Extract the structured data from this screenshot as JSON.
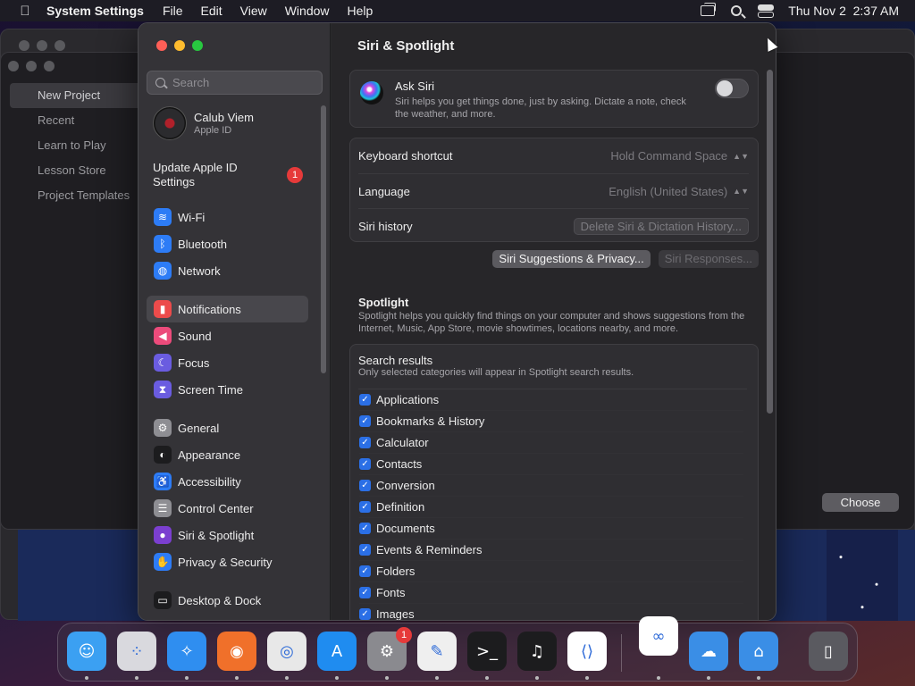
{
  "menubar": {
    "app_name": "System Settings",
    "menus": [
      "File",
      "Edit",
      "View",
      "Window",
      "Help"
    ],
    "datetime": "Thu Nov 2  2:37 AM"
  },
  "background_app": {
    "sidebar_items": [
      "New Project",
      "Recent",
      "Learn to Play",
      "Lesson Store",
      "Project Templates"
    ],
    "choose_button": "Choose"
  },
  "sidebar": {
    "search_placeholder": "Search",
    "profile_name": "Calub Viem",
    "profile_sub": "Apple ID",
    "update_label": "Update Apple ID Settings",
    "update_badge": "1",
    "groups": [
      [
        {
          "label": "Wi-Fi",
          "icon": "wifi-icon",
          "color": "#2d7cf6"
        },
        {
          "label": "Bluetooth",
          "icon": "bluetooth-icon",
          "color": "#2d7cf6"
        },
        {
          "label": "Network",
          "icon": "network-icon",
          "color": "#2d7cf6"
        }
      ],
      [
        {
          "label": "Notifications",
          "icon": "notifications-icon",
          "color": "#ec4b4b",
          "active": true
        },
        {
          "label": "Sound",
          "icon": "sound-icon",
          "color": "#ec4b7b"
        },
        {
          "label": "Focus",
          "icon": "focus-icon",
          "color": "#6a5ce0"
        },
        {
          "label": "Screen Time",
          "icon": "screen-time-icon",
          "color": "#6a5ce0"
        }
      ],
      [
        {
          "label": "General",
          "icon": "general-icon",
          "color": "#8e8e93"
        },
        {
          "label": "Appearance",
          "icon": "appearance-icon",
          "color": "#1c1c1e"
        },
        {
          "label": "Accessibility",
          "icon": "accessibility-icon",
          "color": "#2d7cf6"
        },
        {
          "label": "Control Center",
          "icon": "control-center-icon",
          "color": "#8e8e93"
        },
        {
          "label": "Siri & Spotlight",
          "icon": "siri-icon",
          "color": "#7b3fd0"
        },
        {
          "label": "Privacy & Security",
          "icon": "privacy-hand-icon",
          "color": "#2d7cf6"
        }
      ],
      [
        {
          "label": "Desktop & Dock",
          "icon": "desktop-dock-icon",
          "color": "#1c1c1e"
        }
      ]
    ]
  },
  "main": {
    "title": "Siri & Spotlight",
    "ask_siri": {
      "title": "Ask Siri",
      "description": "Siri helps you get things done, just by asking. Dictate a note, check the weather, and more.",
      "enabled": false
    },
    "keyboard_shortcut": {
      "label": "Keyboard shortcut",
      "value": "Hold Command Space"
    },
    "language": {
      "label": "Language",
      "value": "English (United States)"
    },
    "siri_history": {
      "label": "Siri history",
      "button": "Delete Siri & Dictation History..."
    },
    "suggestions_button": "Siri Suggestions & Privacy...",
    "responses_button": "Siri Responses...",
    "spotlight": {
      "title": "Spotlight",
      "description": "Spotlight helps you quickly find things on your computer and shows suggestions from the Internet, Music, App Store, movie showtimes, locations nearby, and more."
    },
    "search_results": {
      "title": "Search results",
      "description": "Only selected categories will appear in Spotlight search results.",
      "categories": [
        {
          "label": "Applications",
          "checked": true
        },
        {
          "label": "Bookmarks & History",
          "checked": true
        },
        {
          "label": "Calculator",
          "checked": true
        },
        {
          "label": "Contacts",
          "checked": true
        },
        {
          "label": "Conversion",
          "checked": true
        },
        {
          "label": "Definition",
          "checked": true
        },
        {
          "label": "Documents",
          "checked": true
        },
        {
          "label": "Events & Reminders",
          "checked": true
        },
        {
          "label": "Folders",
          "checked": true
        },
        {
          "label": "Fonts",
          "checked": true
        },
        {
          "label": "Images",
          "checked": true
        }
      ]
    }
  },
  "dock": {
    "apps": [
      {
        "name": "finder-icon",
        "color": "#3ba0f2"
      },
      {
        "name": "launchpad-icon",
        "color": "#d9d9de"
      },
      {
        "name": "safari-icon",
        "color": "#2f8ef0"
      },
      {
        "name": "firefox-icon",
        "color": "#f0702a"
      },
      {
        "name": "chrome-icon",
        "color": "#e8e8e8"
      },
      {
        "name": "app-store-icon",
        "color": "#1f8cf0"
      },
      {
        "name": "system-settings-icon",
        "color": "#8a8a8f",
        "badge": "1"
      },
      {
        "name": "textedit-icon",
        "color": "#efefef"
      },
      {
        "name": "terminal-icon",
        "color": "#1c1c1e"
      },
      {
        "name": "garageband-icon",
        "color": "#1c1c1e"
      },
      {
        "name": "vscode-icon",
        "color": "#ffffff"
      },
      {
        "name": "visual-studio-icon",
        "color": "#ffffff"
      },
      {
        "name": "weather-icon",
        "color": "#3a8ee6"
      },
      {
        "name": "keynote-icon",
        "color": "#3a8ee6"
      },
      {
        "name": "trash-icon",
        "color": "#5a5a60"
      }
    ]
  }
}
